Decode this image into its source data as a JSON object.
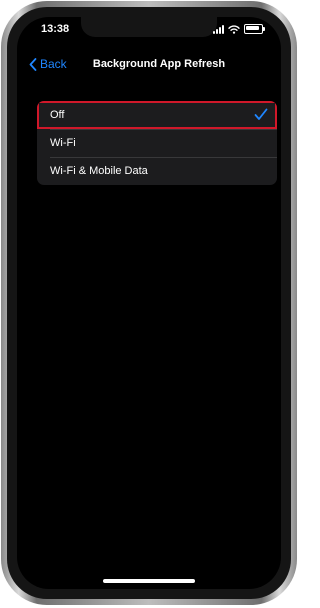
{
  "status_bar": {
    "time": "13:38"
  },
  "navigation": {
    "back_label": "Back",
    "title": "Background App Refresh"
  },
  "options": [
    {
      "label": "Off",
      "selected": true
    },
    {
      "label": "Wi-Fi",
      "selected": false
    },
    {
      "label": "Wi-Fi & Mobile Data",
      "selected": false
    }
  ],
  "icons": {
    "back": "chevron-left-icon",
    "check": "checkmark-icon",
    "signal": "cellular-signal-icon",
    "wifi": "wifi-icon",
    "battery": "battery-icon"
  },
  "colors": {
    "accent": "#1f86ff",
    "highlight": "#d0182a",
    "background": "#000000",
    "group": "#1c1c1e"
  }
}
